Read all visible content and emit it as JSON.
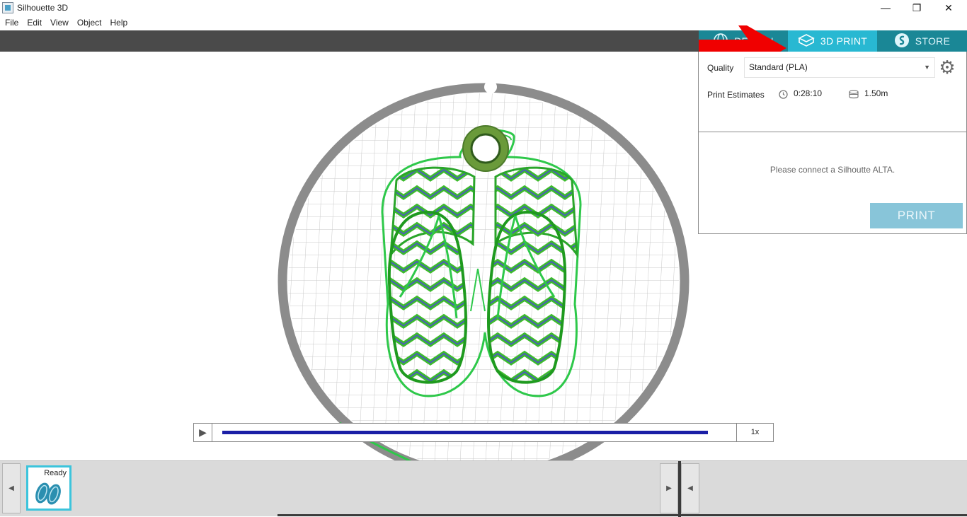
{
  "window": {
    "title": "Silhouette 3D",
    "minimize_glyph": "—",
    "restore_glyph": "❐",
    "close_glyph": "✕"
  },
  "menu": [
    "File",
    "Edit",
    "View",
    "Object",
    "Help"
  ],
  "tabs": {
    "design": {
      "label": "DESIGN",
      "icon": "globe-icon"
    },
    "print": {
      "label": "3D PRINT",
      "icon": "cube-icon"
    },
    "store": {
      "label": "STORE",
      "icon": "silhouette-s-icon"
    }
  },
  "panel": {
    "quality_label": "Quality",
    "quality_value": "Standard (PLA)",
    "estimates_label": "Print Estimates",
    "time_estimate": "0:28:10",
    "filament_estimate": "1.50m",
    "connect_message": "Please connect a Silhoutte ALTA.",
    "print_label": "PRINT"
  },
  "playback": {
    "speed": "1x",
    "progress": 1.0
  },
  "tray": {
    "item_status": "Ready"
  },
  "colors": {
    "tab_active": "#28b8d2",
    "tab_inactive": "#1a8796",
    "print_button": "#88c5d9",
    "arrow": "#f00000",
    "toolpath_green": "#2ecc2e",
    "toolpath_blue": "#4a5fb5",
    "progress": "#1b1fa6"
  }
}
